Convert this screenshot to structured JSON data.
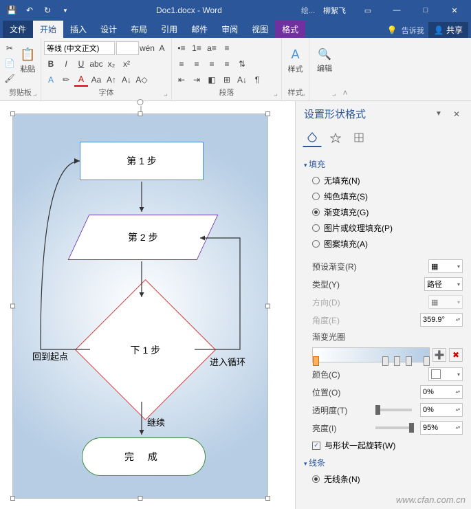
{
  "titlebar": {
    "doc_title": "Doc1.docx - Word",
    "drawing_tools": "绘...",
    "user": "柳絮飞"
  },
  "tabs": {
    "file": "文件",
    "home": "开始",
    "insert": "插入",
    "design": "设计",
    "layout": "布局",
    "references": "引用",
    "mail": "邮件",
    "review": "审阅",
    "view": "视图",
    "format": "格式",
    "tellme": "告诉我",
    "share": "共享"
  },
  "ribbon": {
    "clipboard": {
      "paste": "粘贴",
      "label": "剪贴板"
    },
    "font": {
      "name": "等线 (中文正文)",
      "size": "",
      "label": "字体"
    },
    "paragraph": {
      "label": "段落"
    },
    "styles": {
      "btn": "样式",
      "label": "样式"
    },
    "editing": {
      "btn": "编辑"
    }
  },
  "flowchart": {
    "step1": "第 1 步",
    "step2": "第 2 步",
    "next": "下 1 步",
    "done": "完 成",
    "back": "回到起点",
    "loop": "进入循环",
    "continue": "继续"
  },
  "pane": {
    "title": "设置形状格式",
    "fill_hdr": "填充",
    "fill": {
      "none": "无填充(N)",
      "solid": "纯色填充(S)",
      "gradient": "渐变填充(G)",
      "picture": "图片或纹理填充(P)",
      "pattern": "图案填充(A)"
    },
    "preset": "预设渐变(R)",
    "type": "类型(Y)",
    "type_val": "路径",
    "direction": "方向(D)",
    "angle": "角度(E)",
    "angle_val": "359.9°",
    "stops": "渐变光圈",
    "color": "颜色(C)",
    "position": "位置(O)",
    "position_val": "0%",
    "transparency": "透明度(T)",
    "transparency_val": "0%",
    "brightness": "亮度(I)",
    "brightness_val": "95%",
    "rotate_with": "与形状一起旋转(W)",
    "line_hdr": "线条",
    "line_none": "无线条(N)"
  },
  "watermark": "www.cfan.com.cn"
}
